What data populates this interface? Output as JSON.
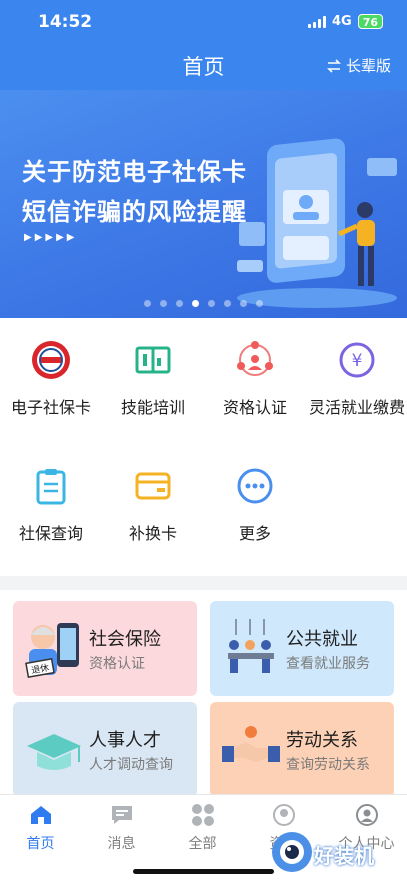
{
  "status_bar": {
    "time": "14:52",
    "network": "4G",
    "battery": "76"
  },
  "nav": {
    "title": "首页",
    "elder_mode": "长辈版"
  },
  "banner": {
    "line1": "关于防范电子社保卡",
    "line2": "短信诈骗的风险提醒",
    "arrows": "▶▶▶▶▶",
    "page_count": 8,
    "active_page": 4
  },
  "services": [
    {
      "label": "电子社保卡",
      "icon": "social-security-seal-icon"
    },
    {
      "label": "技能培训",
      "icon": "book-icon"
    },
    {
      "label": "资格认证",
      "icon": "people-network-icon"
    },
    {
      "label": "灵活就业缴费",
      "icon": "yuan-coin-icon"
    },
    {
      "label": "社保查询",
      "icon": "clipboard-icon"
    },
    {
      "label": "补换卡",
      "icon": "card-icon"
    },
    {
      "label": "更多",
      "icon": "more-dots-icon"
    }
  ],
  "cards": [
    {
      "title": "社会保险",
      "subtitle": "资格认证",
      "badge": "退休",
      "color": "#fcd9dc",
      "icon": "elderly-phone-icon"
    },
    {
      "title": "公共就业",
      "subtitle": "查看就业服务",
      "color": "#cfe8fb",
      "icon": "meeting-icon"
    },
    {
      "title": "人事人才",
      "subtitle": "人才调动查询",
      "color": "#d9e6f3",
      "icon": "graduation-cap-icon"
    },
    {
      "title": "劳动关系",
      "subtitle": "查询劳动关系",
      "color": "#fdd1b6",
      "icon": "handshake-icon"
    }
  ],
  "tabs": [
    {
      "label": "首页",
      "icon": "home-icon",
      "active": true
    },
    {
      "label": "消息",
      "icon": "message-icon"
    },
    {
      "label": "全部",
      "icon": "grid-icon"
    },
    {
      "label": "资讯",
      "icon": "news-icon"
    },
    {
      "label": "个人中心",
      "icon": "person-icon"
    }
  ],
  "watermark": {
    "text": "好装机"
  },
  "colors": {
    "primary": "#3b86ee",
    "tab_active": "#2f7cf0"
  }
}
